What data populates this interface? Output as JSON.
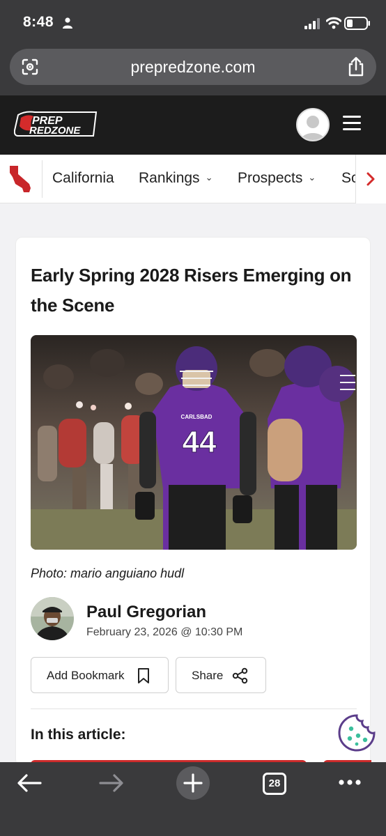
{
  "status_bar": {
    "time": "8:48"
  },
  "browser": {
    "url": "prepredzone.com",
    "tab_count": "28"
  },
  "site": {
    "logo_line1": "PREP",
    "logo_line2": "REDZONE",
    "nav": [
      {
        "label": "California"
      },
      {
        "label": "Rankings"
      },
      {
        "label": "Prospects"
      },
      {
        "label": "Sc"
      }
    ]
  },
  "article": {
    "title": "Early Spring 2028 Risers Emerging on the Scene",
    "caption": "Photo: mario anguiano hudl",
    "author": "Paul Gregorian",
    "date": "February 23, 2026 @ 10:30 PM",
    "bookmark_label": "Add Bookmark",
    "share_label": "Share",
    "in_this_article": "In this article:",
    "jersey_text": "CARLSBAD",
    "jersey_number": "44"
  },
  "colors": {
    "accent_red": "#cc2b2b",
    "browser_chrome": "#3a3a3c",
    "header_bg": "#1c1c1c",
    "cookie_purple": "#5b3d8a"
  },
  "icons": [
    "person-icon",
    "signal-icon",
    "wifi-icon",
    "battery-icon",
    "lens-icon",
    "share-icon",
    "hamburger-icon",
    "california-icon",
    "chevron-right-icon",
    "bookmark-icon",
    "share-nodes-icon",
    "cookie-icon",
    "back-arrow-icon",
    "forward-arrow-icon",
    "plus-icon",
    "tabs-icon",
    "more-icon"
  ]
}
